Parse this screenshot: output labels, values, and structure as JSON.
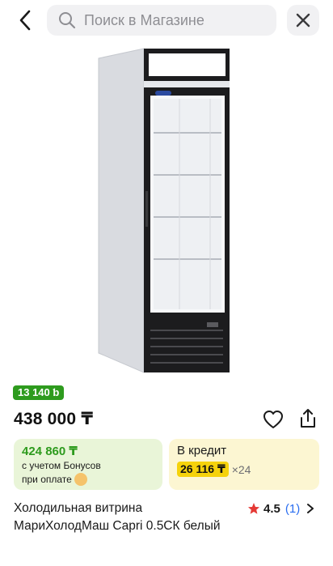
{
  "search": {
    "placeholder": "Поиск в Магазине"
  },
  "product": {
    "bonus_badge": "13 140 ƅ",
    "price": "438 000 ₸",
    "title": "Холодильная витрина МариХолодМаш Capri 0.5СК белый",
    "rating": "4.5",
    "reviews": "(1)"
  },
  "bonus_card": {
    "amount": "424 860 ₸",
    "note_line1": "с учетом Бонусов",
    "note_line2": "при оплате"
  },
  "credit_card": {
    "title": "В кредит",
    "installment": "26 116 ₸",
    "months": "×24"
  },
  "colors": {
    "accent_green": "#2e9b1e",
    "credit_yellow": "#f5d20b",
    "star_red": "#e53935",
    "link_blue": "#2a6ef0"
  }
}
